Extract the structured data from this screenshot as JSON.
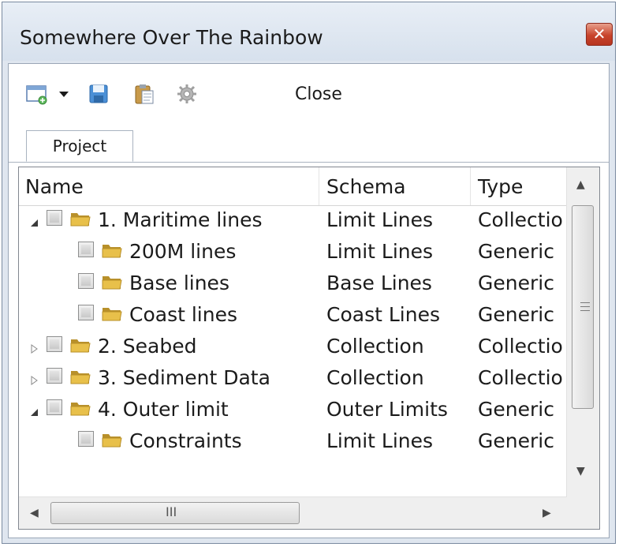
{
  "window": {
    "title": "Somewhere Over The Rainbow",
    "close_glyph": "✕"
  },
  "toolbar": {
    "new_icon": "new-window-icon",
    "dropdown_icon": "triangle-down-icon",
    "save_icon": "floppy-disk-icon",
    "paste_icon": "clipboard-icon",
    "settings_icon": "gear-icon",
    "close_label": "Close"
  },
  "tabs": [
    {
      "label": "Project"
    }
  ],
  "table": {
    "columns": [
      "Name",
      "Schema",
      "Type"
    ],
    "rows": [
      {
        "name": "1. Maritime lines",
        "schema": "Limit Lines",
        "type": "Collectio",
        "expander": "expanded",
        "level": 0
      },
      {
        "name": "200M lines",
        "schema": "Limit Lines",
        "type": "Generic",
        "expander": "none",
        "level": 1
      },
      {
        "name": "Base lines",
        "schema": "Base Lines",
        "type": "Generic",
        "expander": "none",
        "level": 1
      },
      {
        "name": "Coast lines",
        "schema": "Coast Lines",
        "type": "Generic",
        "expander": "none",
        "level": 1
      },
      {
        "name": "2. Seabed",
        "schema": "Collection",
        "type": "Collectio",
        "expander": "collapsed",
        "level": 0
      },
      {
        "name": "3. Sediment Data",
        "schema": "Collection",
        "type": "Collectio",
        "expander": "collapsed",
        "level": 0
      },
      {
        "name": "4. Outer limit",
        "schema": "Outer Limits",
        "type": "Generic",
        "expander": "expanded",
        "level": 0
      },
      {
        "name": "Constraints",
        "schema": "Limit Lines",
        "type": "Generic",
        "expander": "none",
        "level": 1
      }
    ]
  },
  "scrollbars": {
    "up_arrow": "▲",
    "down_arrow": "▼",
    "left_arrow": "◀",
    "right_arrow": "▶",
    "h_grip": "III"
  },
  "colors": {
    "folder": "#e8c04a",
    "folder_dark": "#b8902a",
    "accent_blue": "#3a78c3"
  }
}
